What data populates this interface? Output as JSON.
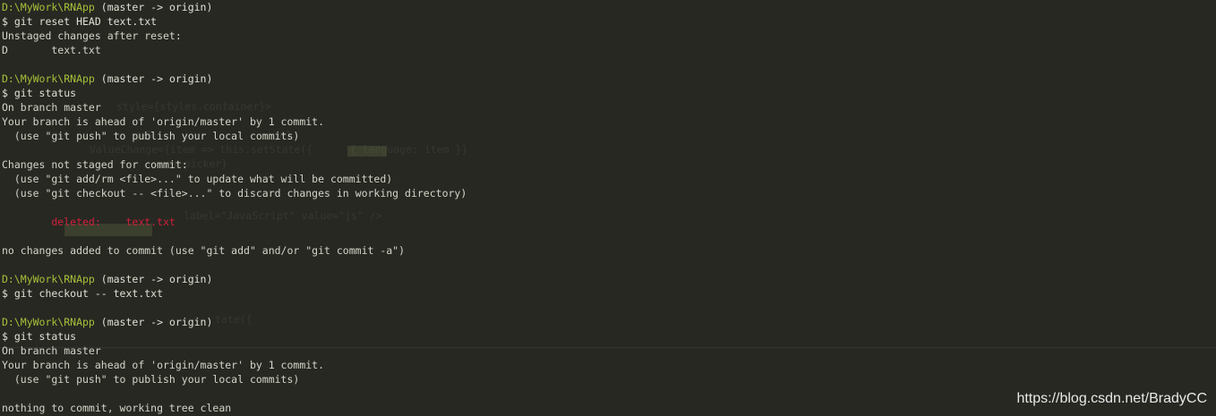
{
  "colors": {
    "background": "#272822",
    "prompt_path": "#a6c13a",
    "text": "#dcdcd2",
    "deleted": "#d01f3c"
  },
  "lines": [
    {
      "type": "prompt",
      "path": "D:\\MyWork\\RNApp",
      "branch": " (master -> origin)"
    },
    {
      "type": "command",
      "text": "$ git reset HEAD text.txt"
    },
    {
      "type": "output",
      "text": "Unstaged changes after reset:"
    },
    {
      "type": "output",
      "text": "D       text.txt"
    },
    {
      "type": "blank",
      "text": ""
    },
    {
      "type": "prompt",
      "path": "D:\\MyWork\\RNApp",
      "branch": " (master -> origin)"
    },
    {
      "type": "command",
      "text": "$ git status"
    },
    {
      "type": "output",
      "text": "On branch master"
    },
    {
      "type": "output",
      "text": "Your branch is ahead of 'origin/master' by 1 commit."
    },
    {
      "type": "output",
      "text": "  (use \"git push\" to publish your local commits)"
    },
    {
      "type": "blank",
      "text": ""
    },
    {
      "type": "output",
      "text": "Changes not staged for commit:"
    },
    {
      "type": "output",
      "text": "  (use \"git add/rm <file>...\" to update what will be committed)"
    },
    {
      "type": "output",
      "text": "  (use \"git checkout -- <file>...\" to discard changes in working directory)"
    },
    {
      "type": "blank",
      "text": ""
    },
    {
      "type": "deleted",
      "text": "        deleted:    text.txt"
    },
    {
      "type": "blank",
      "text": ""
    },
    {
      "type": "output",
      "text": "no changes added to commit (use \"git add\" and/or \"git commit -a\")"
    },
    {
      "type": "blank",
      "text": ""
    },
    {
      "type": "prompt",
      "path": "D:\\MyWork\\RNApp",
      "branch": " (master -> origin)"
    },
    {
      "type": "command",
      "text": "$ git checkout -- text.txt"
    },
    {
      "type": "blank",
      "text": ""
    },
    {
      "type": "prompt",
      "path": "D:\\MyWork\\RNApp",
      "branch": " (master -> origin)"
    },
    {
      "type": "command",
      "text": "$ git status"
    },
    {
      "type": "output",
      "text": "On branch master"
    },
    {
      "type": "output",
      "text": "Your branch is ahead of 'origin/master' by 1 commit."
    },
    {
      "type": "output",
      "text": "  (use \"git push\" to publish your local commits)"
    },
    {
      "type": "blank",
      "text": ""
    },
    {
      "type": "output",
      "text": "nothing to commit, working tree clean"
    }
  ],
  "watermark": "https://blog.csdn.net/BradyCC"
}
